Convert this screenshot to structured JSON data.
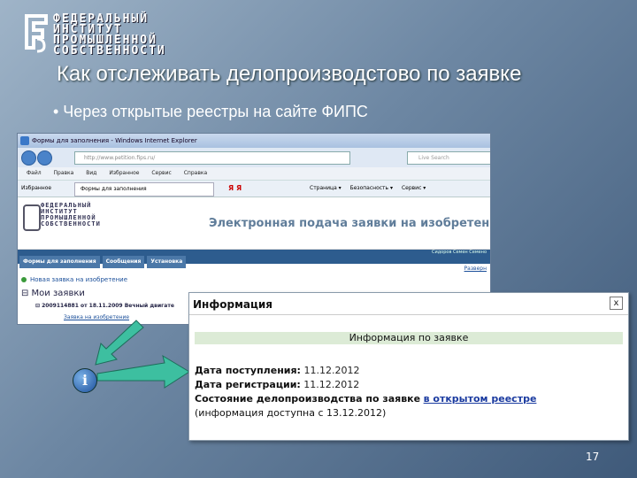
{
  "logo": {
    "lines": [
      "ФЕДЕРАЛЬНЫЙ",
      "ИНСТИТУТ",
      "ПРОМЫШЛЕННОЙ",
      "СОБСТВЕННОСТИ"
    ]
  },
  "slide": {
    "title": "Как отслеживать делопроизводстово по заявке",
    "bullet": "• Через открытые реестры на сайте ФИПС",
    "page_number": "17"
  },
  "browser": {
    "window_title": "Формы для заполнения - Windows Internet Explorer",
    "url": "http://www.petition.fips.ru/",
    "search_placeholder": "Live Search",
    "menu": [
      "Файл",
      "Правка",
      "Вид",
      "Избранное",
      "Сервис",
      "Справка"
    ],
    "favorites_label": "Избранное",
    "tab_label": "Формы для заполнения",
    "yandex": "Я Я",
    "tools": [
      "Страница ▾",
      "Безопасность ▾",
      "Сервис ▾"
    ]
  },
  "site": {
    "logo_lines": [
      "ФЕДЕРАЛЬНЫЙ",
      "ИНСТИТУТ",
      "ПРОМЫШЛЕННОЙ",
      "СОБСТВЕННОСТИ"
    ],
    "header": "Электронная подача заявки на изобретения",
    "tabs": [
      "Формы для заполнения",
      "Сообщения",
      "Установка"
    ],
    "user": "Сидоров Семен Семено",
    "link_right": "Разверн",
    "new_app": "Новая заявка на изобретение",
    "my_apps": "⊟ Мои заявки",
    "request": "⊟ 2009114881 от 18.11.2009 Вечный двигате",
    "app_link": "Заявка на изобретение"
  },
  "popup": {
    "title": "Информация",
    "close": "x",
    "band": "Информация по заявке",
    "receipt_label": "Дата поступления:",
    "receipt_value": "11.12.2012",
    "registration_label": "Дата регистрации:",
    "registration_value": "11.12.2012",
    "status_label": "Состояние делопроизводства по заявке",
    "status_link": "в открытом реестре",
    "note": "(информация доступна с 13.12.2012)"
  }
}
